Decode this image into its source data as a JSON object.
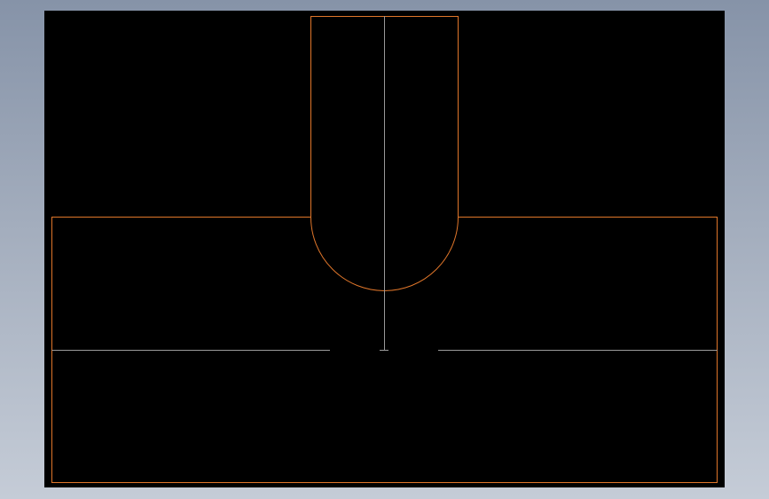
{
  "drawing": {
    "outline_color": "#e0762a",
    "centerline_color": "#9a9a9a",
    "background": "#000000"
  }
}
